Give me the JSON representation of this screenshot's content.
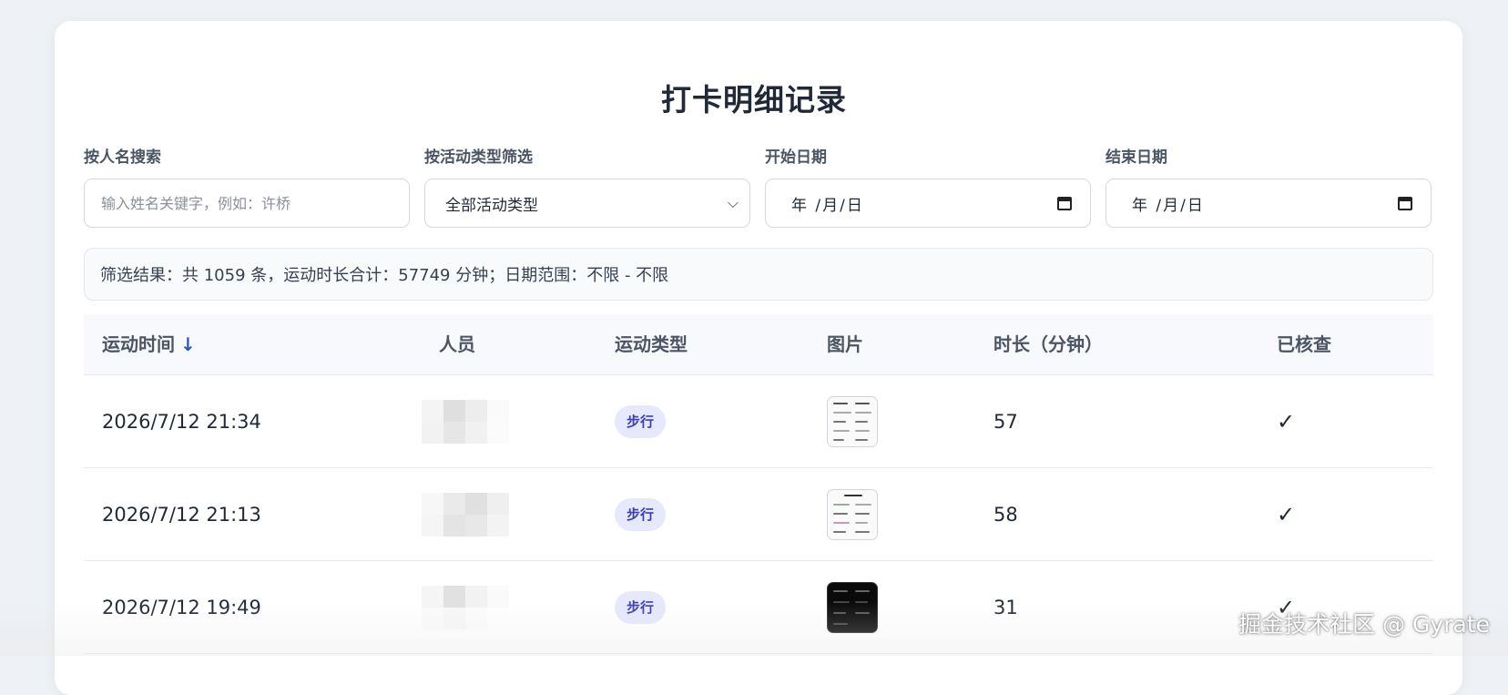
{
  "title": "打卡明细记录",
  "filters": {
    "name": {
      "label": "按人名搜索",
      "placeholder": "输入姓名关键字，例如：许桥",
      "value": ""
    },
    "type": {
      "label": "按活动类型筛选",
      "selected": "全部活动类型",
      "icon": "chevron-down-icon"
    },
    "start_date": {
      "label": "开始日期",
      "display": "年 /月/日",
      "icon": "calendar-icon"
    },
    "end_date": {
      "label": "结束日期",
      "display": "年 /月/日",
      "icon": "calendar-icon"
    }
  },
  "summary": "筛选结果：共 1059 条，运动时长合计：57749 分钟；日期范围：不限 - 不限",
  "table": {
    "headers": {
      "time": "运动时间",
      "sort_indicator": "↓",
      "person": "人员",
      "type": "运动类型",
      "image": "图片",
      "duration": "时长（分钟）",
      "checked": "已核查"
    },
    "rows": [
      {
        "time": "2026/7/12 21:34",
        "type": "步行",
        "image_theme": "light",
        "duration": "57",
        "checked": "✓"
      },
      {
        "time": "2026/7/12 21:13",
        "type": "步行",
        "image_theme": "light",
        "duration": "58",
        "checked": "✓"
      },
      {
        "time": "2026/7/12 19:49",
        "type": "步行",
        "image_theme": "dark",
        "duration": "31",
        "checked": "✓"
      }
    ]
  },
  "colors": {
    "accent": "#2b59c3",
    "badge_bg": "#e6e8fb",
    "badge_text": "#3d3fb0"
  },
  "watermark": "掘金技术社区 @ Gyrate"
}
